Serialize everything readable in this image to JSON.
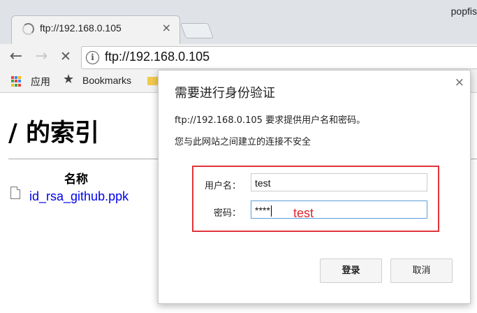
{
  "browser": {
    "tab_title": "ftp://192.168.0.105",
    "tab_close": "×",
    "profile_name": "popfis",
    "url": "ftp://192.168.0.105",
    "back": "←",
    "forward": "→",
    "stop": "✕",
    "info": "i"
  },
  "bookmarks_bar": {
    "apps_label": "应用",
    "star": "★",
    "bookmarks_label": "Bookmarks"
  },
  "page": {
    "title": "/ 的索引",
    "column_name": "名称",
    "files": [
      "id_rsa_github.ppk"
    ]
  },
  "dialog": {
    "title": "需要进行身份验证",
    "close": "×",
    "message": "ftp://192.168.0.105 要求提供用户名和密码。",
    "warning": "您与此网站之间建立的连接不安全",
    "username_label": "用户名：",
    "username_value": "test",
    "password_label": "密码：",
    "password_value": "****",
    "annotation": "test",
    "login_button": "登录",
    "cancel_button": "取消",
    "highlight_color": "#e0343a"
  }
}
